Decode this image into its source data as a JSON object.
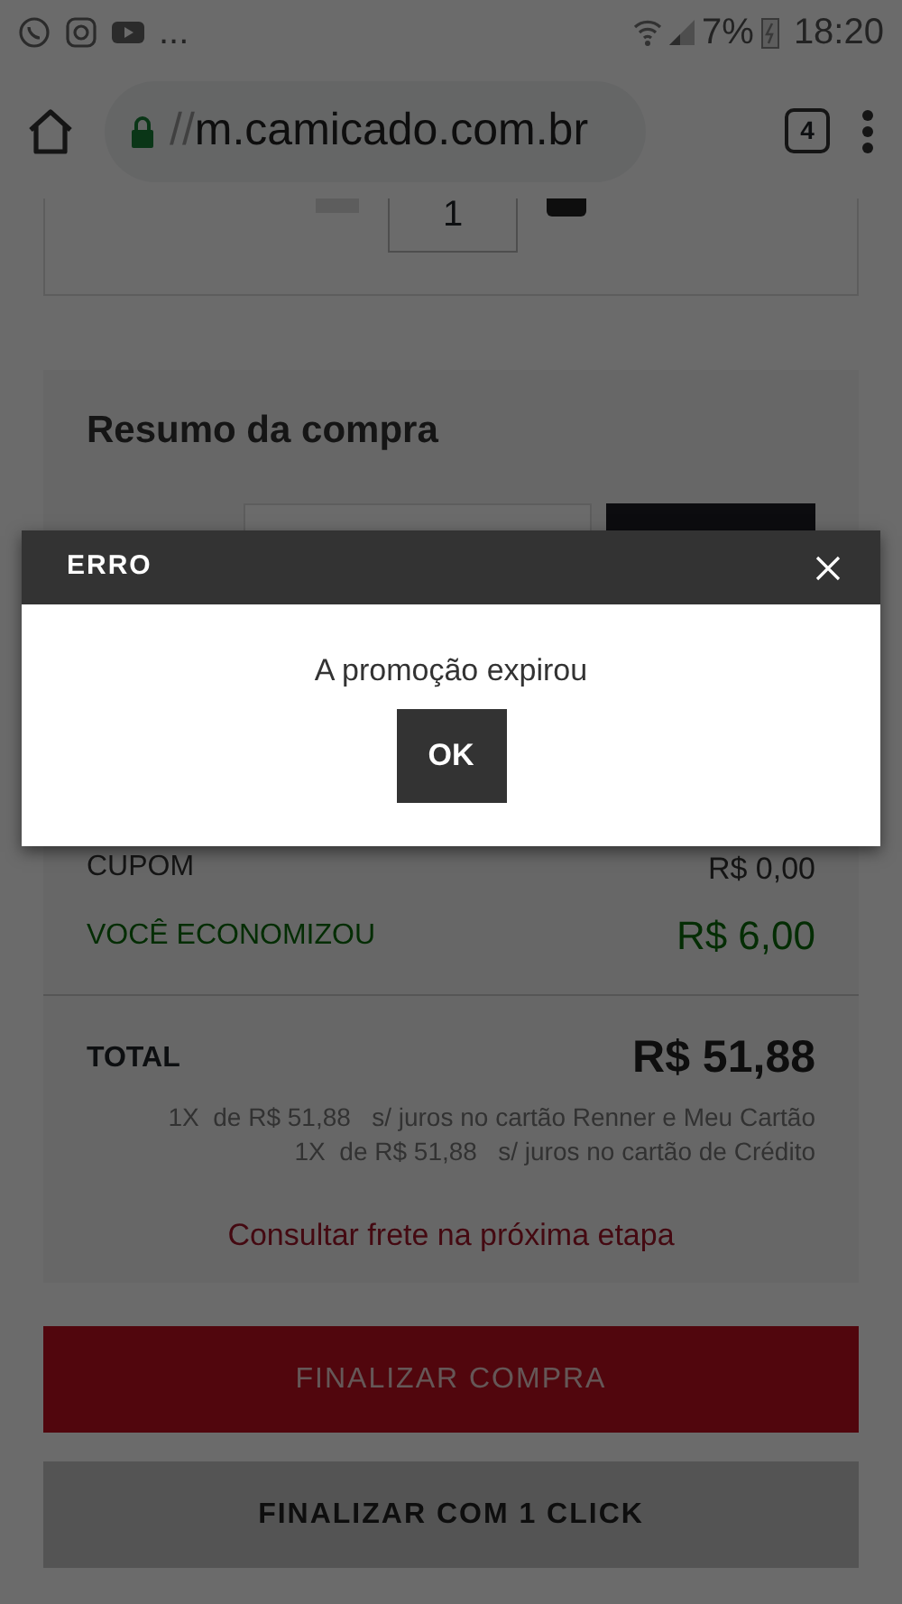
{
  "status_bar": {
    "more": "...",
    "battery": "7%",
    "time": "18:20"
  },
  "browser": {
    "url_scheme": "//",
    "url_host": "m.camicado.com.br",
    "tab_count": "4"
  },
  "cart_item": {
    "quantity": "1"
  },
  "summary": {
    "title": "Resumo da compra",
    "rows": [
      {
        "label": "CUPOM",
        "value": "R$ 0,00",
        "kind": "plain"
      },
      {
        "label": "VOCÊ ECONOMIZOU",
        "value": "R$ 6,00",
        "kind": "savings"
      }
    ],
    "total": {
      "label": "TOTAL",
      "value": "R$ 51,88"
    },
    "installments": [
      "1X  de R$ 51,88   s/ juros no cartão Renner e Meu Cartão",
      "1X  de R$ 51,88   s/ juros no cartão de Crédito"
    ],
    "shipping_note": "Consultar frete na próxima etapa"
  },
  "buttons": [
    {
      "label": "FINALIZAR COMPRA",
      "kind": "primary"
    },
    {
      "label": "FINALIZAR COM 1 CLICK",
      "kind": "secondary"
    }
  ],
  "dialog": {
    "title": "ERRO",
    "message": "A promoção expirou",
    "button": "OK"
  }
}
